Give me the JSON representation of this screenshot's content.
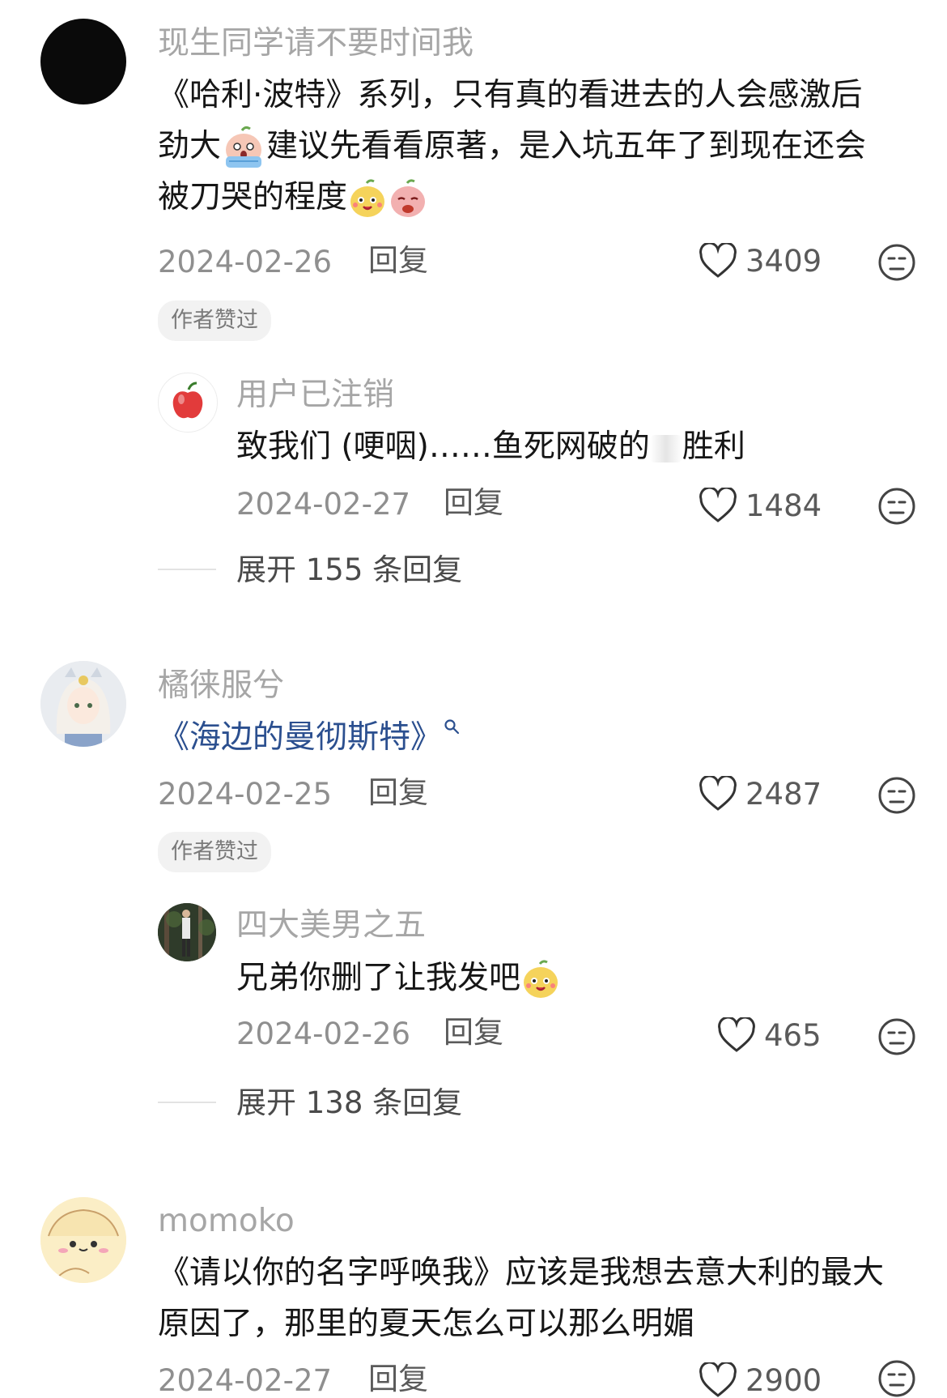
{
  "comments": [
    {
      "username": "现生同学请不要时间我",
      "text_lines": [
        "《哈利·波特》系列，只有真的看进去的人会感激后",
        "劲大",
        "建议先看看原著，是入坑五年了到现在还会",
        "被刀哭的程度"
      ],
      "date": "2024-02-26",
      "reply_label": "回复",
      "likes": "3409",
      "badge": "作者赞过",
      "sub_reply": {
        "username": "用户已注销",
        "text_a": "致我们 (哽咽)……鱼死网破的",
        "text_b": "胜利",
        "date": "2024-02-27",
        "reply_label": "回复",
        "likes": "1484"
      },
      "expand": "展开 155 条回复"
    },
    {
      "username": "橘徕服兮",
      "text": "《海边的曼彻斯特》",
      "date": "2024-02-25",
      "reply_label": "回复",
      "likes": "2487",
      "badge": "作者赞过",
      "sub_reply": {
        "username": "四大美男之五",
        "text": "兄弟你删了让我发吧",
        "date": "2024-02-26",
        "reply_label": "回复",
        "likes": "465"
      },
      "expand": "展开 138 条回复"
    },
    {
      "username": "momoko",
      "text_lines": [
        "《请以你的名字呼唤我》应该是我想去意大利的最大",
        "原因了，那里的夏天怎么可以那么明媚"
      ],
      "date": "2024-02-27",
      "reply_label": "回复",
      "likes": "2900"
    }
  ],
  "colors": {
    "username": "#a6a6a6",
    "link": "#2b4f8f",
    "text": "#161616"
  }
}
